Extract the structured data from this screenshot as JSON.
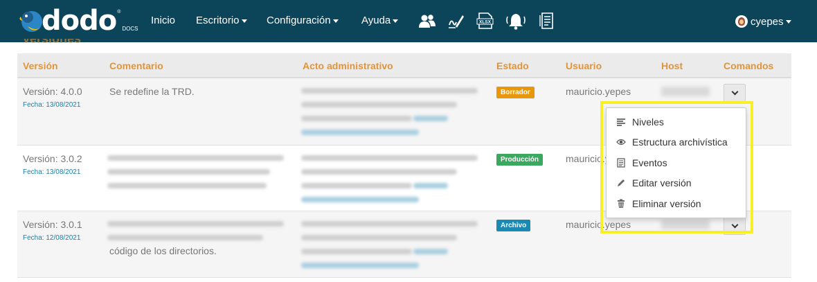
{
  "navbar": {
    "logo_text": "dodo",
    "logo_sub": "DOCS",
    "logo_reg": "®",
    "items": [
      {
        "label": "Inicio",
        "has_caret": false
      },
      {
        "label": "Escritorio",
        "has_caret": true
      },
      {
        "label": "Configuración",
        "has_caret": true
      },
      {
        "label": "Ayuda",
        "has_caret": true
      }
    ],
    "icons": [
      "users-icon",
      "signature-icon",
      "xlsx-file-icon",
      "notification-bell-icon",
      "document-list-icon"
    ],
    "user": {
      "name": "cyepes"
    }
  },
  "section_title": "Versiones",
  "table": {
    "headers": [
      "Versión",
      "Comentario",
      "Acto administrativo",
      "Estado",
      "Usuario",
      "Host",
      "Comandos"
    ],
    "rows": [
      {
        "version": "Versión: 4.0.0",
        "fecha": "Fecha: 13/08/2021",
        "comentario": "Se redefine la TRD.",
        "comentario_tail": "",
        "estado": "Borrador",
        "estado_color": "#e8960b",
        "usuario": "mauricio.yepes"
      },
      {
        "version": "Versión: 3.0.2",
        "fecha": "Fecha: 13/08/2021",
        "comentario": "",
        "comentario_tail": "",
        "estado": "Producción",
        "estado_color": "#3aa85f",
        "usuario": "mauricio.yepes"
      },
      {
        "version": "Versión: 3.0.1",
        "fecha": "Fecha: 12/08/2021",
        "comentario": "",
        "comentario_tail": "código de los directorios.",
        "estado": "Archivo",
        "estado_color": "#1a8ab5",
        "usuario": "mauricio.yepes"
      }
    ]
  },
  "dropdown": {
    "items": [
      {
        "label": "Niveles",
        "icon": "list-lines-icon"
      },
      {
        "label": "Estructura archivística",
        "icon": "eye-icon"
      },
      {
        "label": "Eventos",
        "icon": "log-document-icon"
      },
      {
        "label": "Editar versión",
        "icon": "pencil-icon"
      },
      {
        "label": "Eliminar versión",
        "icon": "trash-icon"
      }
    ]
  },
  "colors": {
    "navbar": "#0c4459",
    "header_text": "#e39437",
    "highlight": "#f8ef27"
  }
}
